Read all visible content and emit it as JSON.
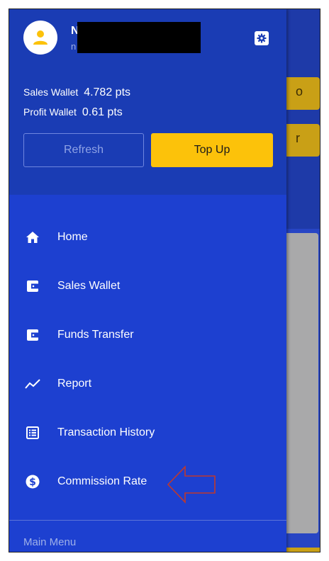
{
  "user": {
    "name_initial": "N",
    "sub_initial": "n"
  },
  "wallets": {
    "sales_label": "Sales Wallet",
    "sales_value": "4.782 pts",
    "profit_label": "Profit Wallet",
    "profit_value": "0.61 pts"
  },
  "buttons": {
    "refresh": "Refresh",
    "top_up": "Top Up"
  },
  "background": {
    "btn1_char": "o",
    "btn2_char": "r"
  },
  "menu": {
    "items": [
      {
        "label": "Home",
        "icon": "home-icon"
      },
      {
        "label": "Sales Wallet",
        "icon": "wallet-icon"
      },
      {
        "label": "Funds Transfer",
        "icon": "wallet-icon"
      },
      {
        "label": "Report",
        "icon": "trending-icon"
      },
      {
        "label": "Transaction History",
        "icon": "list-icon"
      },
      {
        "label": "Commission Rate",
        "icon": "dollar-circle-icon"
      }
    ],
    "footer_label": "Main Menu"
  },
  "colors": {
    "drawer": "#1d40d0",
    "header": "#1a3cb4",
    "accent": "#fcc20a",
    "annotation_arrow": "#c0392b"
  }
}
